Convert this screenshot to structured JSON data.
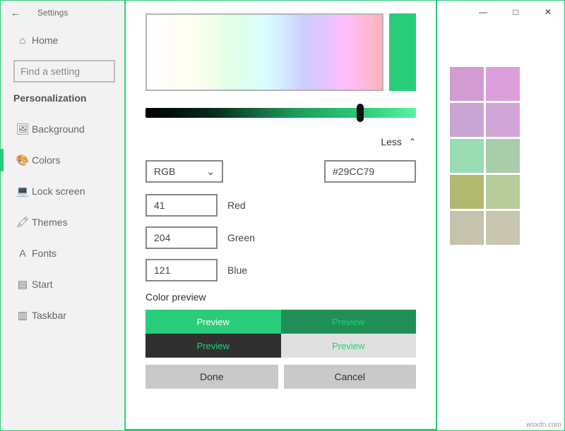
{
  "header": {
    "title": "Settings"
  },
  "sidebar": {
    "home_label": "Home",
    "search_placeholder": "Find a setting",
    "section_label": "Personalization",
    "items": [
      {
        "label": "Background"
      },
      {
        "label": "Colors"
      },
      {
        "label": "Lock screen"
      },
      {
        "label": "Themes"
      },
      {
        "label": "Fonts"
      },
      {
        "label": "Start"
      },
      {
        "label": "Taskbar"
      }
    ]
  },
  "picker": {
    "current_color": "#29CC79",
    "toggle_label": "Less",
    "mode": "RGB",
    "hex": "#29CC79",
    "rgb": {
      "red": {
        "value": "41",
        "label": "Red"
      },
      "green": {
        "value": "204",
        "label": "Green"
      },
      "blue": {
        "value": "121",
        "label": "Blue"
      }
    },
    "preview_title": "Color preview",
    "preview_label": "Preview",
    "done_label": "Done",
    "cancel_label": "Cancel",
    "slider_position_pct": 78
  },
  "swatches": [
    "#d29bd2",
    "#dd9edc",
    "#c7a4d2",
    "#d1a6d7",
    "#99dcb3",
    "#a9ccab",
    "#b1b86f",
    "#b8cb9a",
    "#c5c2ae",
    "#c8c5b1"
  ],
  "credit": "wsxdn.com"
}
